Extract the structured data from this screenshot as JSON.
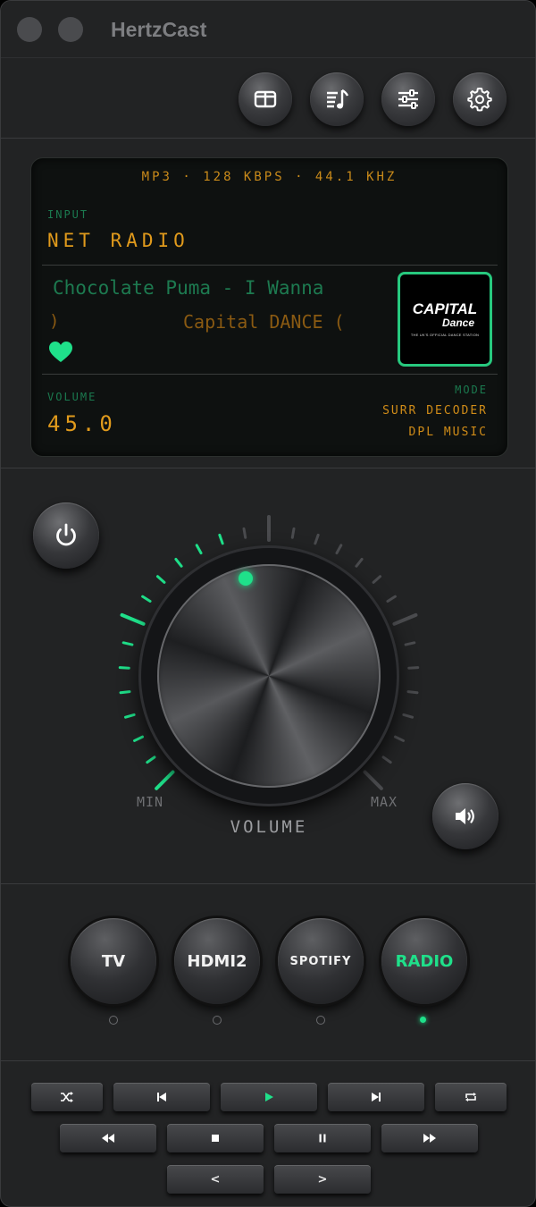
{
  "app": {
    "title": "HertzCast"
  },
  "toolbar": {
    "icons": [
      "split-view-icon",
      "playlist-icon",
      "equalizer-icon",
      "settings-icon"
    ]
  },
  "display": {
    "format": "MP3 · 128 KBPS · 44.1 KHZ",
    "input_label": "INPUT",
    "input_value": "NET RADIO",
    "track_title": "Chocolate Puma - I Wanna",
    "track_paren": ")",
    "station": "Capital DANCE (",
    "favorite": true,
    "logo": {
      "main": "CAPITAL",
      "sub": "Dance",
      "tagline": "THE UK'S OFFICIAL DANCE STATION"
    },
    "volume_label": "VOLUME",
    "volume_value": "45.0",
    "mode_label": "MODE",
    "mode_value_1": "SURR DECODER",
    "mode_value_2": "DPL MUSIC"
  },
  "dial": {
    "min_label": "MIN",
    "max_label": "MAX",
    "title": "VOLUME",
    "level": 0.45,
    "accent_color": "#1fe08a"
  },
  "sources": [
    {
      "label": "TV",
      "active": false
    },
    {
      "label": "HDMI2",
      "active": false
    },
    {
      "label": "SPOTIFY",
      "active": false
    },
    {
      "label": "RADIO",
      "active": true
    }
  ],
  "transport": {
    "prev_track_label": "<",
    "next_track_label": ">"
  }
}
